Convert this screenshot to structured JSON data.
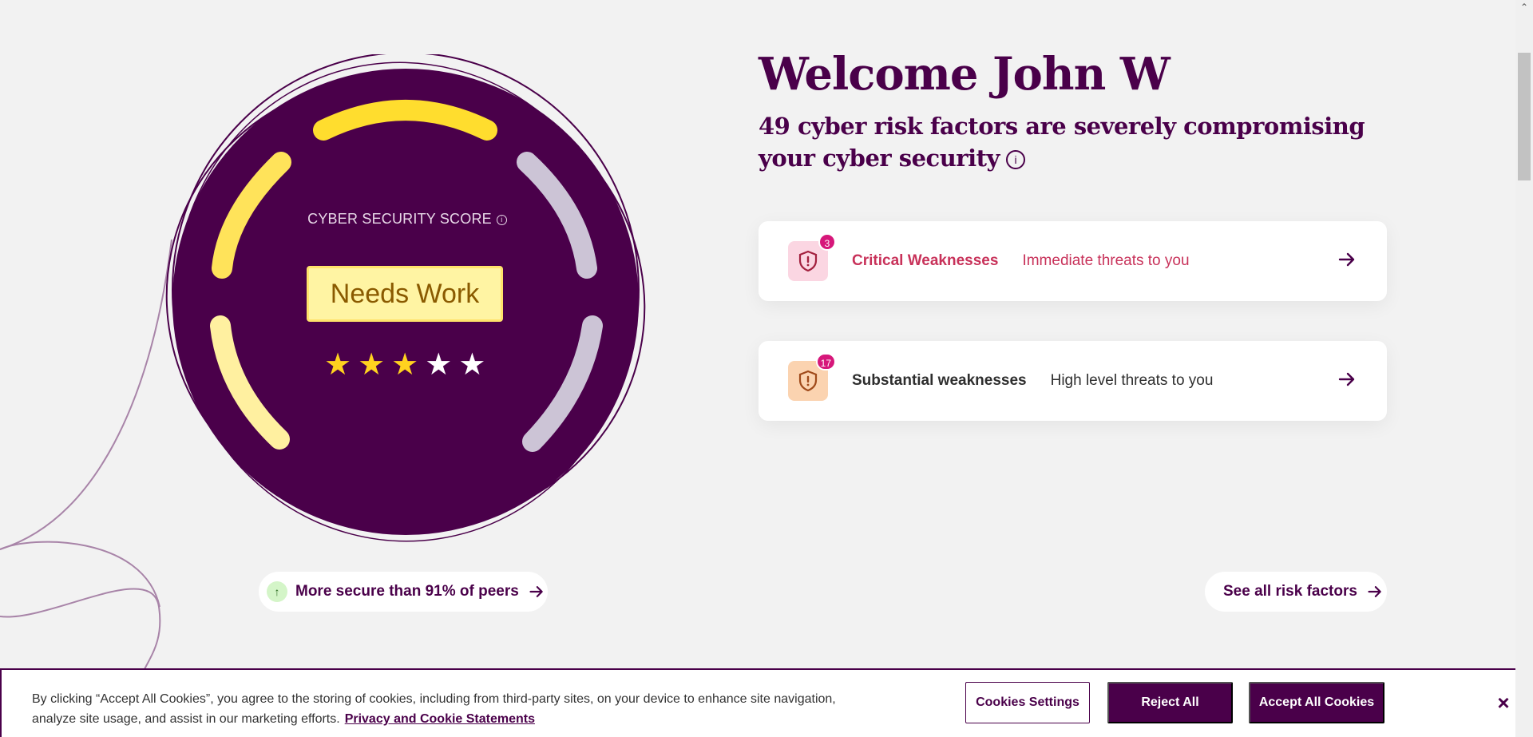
{
  "welcome": {
    "title": "Welcome John W",
    "subtitle": "49 cyber risk factors are severely compromising your cyber security"
  },
  "score": {
    "label": "CYBER SECURITY SCORE",
    "status": "Needs Work",
    "rating": 3,
    "max_rating": 5,
    "stars": [
      "★",
      "★",
      "★",
      "★",
      "★"
    ]
  },
  "cards": [
    {
      "count": "3",
      "title": "Critical Weaknesses",
      "description": "Immediate threats to you",
      "icon": "shield-alert-icon",
      "accent": "#c8325a"
    },
    {
      "count": "17",
      "title": "Substantial weaknesses",
      "description": "High level threats to you",
      "icon": "shield-alert-icon",
      "accent": "#2e2e2e"
    }
  ],
  "peers": {
    "label": "More secure than 91% of peers"
  },
  "see_all": {
    "label": "See all risk factors"
  },
  "cookie": {
    "text": "By clicking “Accept All Cookies”, you agree to the storing of cookies, including from third-party sites, on your device to enhance site navigation, analyze site usage, and assist in our marketing efforts.",
    "link": "Privacy and Cookie Statements",
    "settings_label": "Cookies Settings",
    "reject_label": "Reject All",
    "accept_label": "Accept All Cookies",
    "close_label": "×"
  },
  "colors": {
    "brand": "#4a004a",
    "critical": "#c8325a",
    "badge": "#d6177a",
    "gauge_on": "#ffd21f",
    "gauge_off": "#ccc4d6"
  }
}
